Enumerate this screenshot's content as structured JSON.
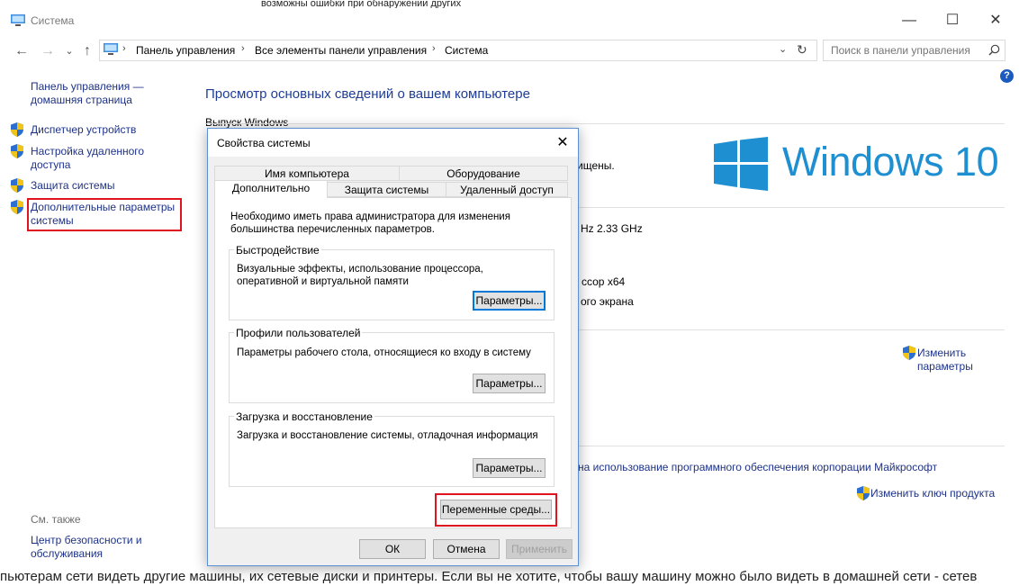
{
  "background_page": {
    "top_fragment": "возможны ошибки при обнаружении других",
    "bottom_fragment": "пьютерам сети видеть другие машины, их сетевые диски и принтеры. Если вы не хотите, чтобы вашу машину можно было видеть в домашней сети - сетев"
  },
  "window": {
    "title": "Система",
    "controls": {
      "minimize": "—",
      "maximize": "☐",
      "close": "✕"
    }
  },
  "nav": {
    "back": "←",
    "forward": "→",
    "dropdown": "⌄",
    "up": "↑",
    "breadcrumbs": [
      "Панель управления",
      "Все элементы панели управления",
      "Система"
    ],
    "refresh": "↻",
    "search_placeholder": "Поиск в панели управления",
    "help": "?"
  },
  "sidebar": {
    "home_link": "Панель управления —\nдомашняя страница",
    "items": [
      "Диспетчер устройств",
      "Настройка удаленного\nдоступа",
      "Защита системы",
      "Дополнительные параметры\nсистемы"
    ],
    "see_also_label": "См. также",
    "see_also_items": [
      "Центр безопасности и\nобслуживания"
    ]
  },
  "main": {
    "heading": "Просмотр основных сведений о вашем компьютере",
    "edition_label": "Выпуск Windows",
    "frag_protected": "ищены.",
    "frag_speed": "Hz  2.33 GHz",
    "frag_processor": "ссор x64",
    "frag_screen": "ого экрана",
    "change_params": "Изменить\nпараметры",
    "license_link": "на использование программного обеспечения корпорации Майкрософт",
    "change_key": "Изменить ключ продукта",
    "logo_text": "Windows 10"
  },
  "dialog": {
    "title": "Свойства системы",
    "close": "✕",
    "tabs_row1": [
      "Имя компьютера",
      "Оборудование"
    ],
    "tabs_row2": [
      "Дополнительно",
      "Защита системы",
      "Удаленный доступ"
    ],
    "admin_note": "Необходимо иметь права администратора для изменения большинства перечисленных параметров.",
    "performance": {
      "title": "Быстродействие",
      "desc": "Визуальные эффекты, использование процессора, оперативной и виртуальной памяти",
      "button": "Параметры..."
    },
    "profiles": {
      "title": "Профили пользователей",
      "desc": "Параметры рабочего стола, относящиеся ко входу в систему",
      "button": "Параметры..."
    },
    "startup": {
      "title": "Загрузка и восстановление",
      "desc": "Загрузка и восстановление системы, отладочная информация",
      "button": "Параметры..."
    },
    "env_button": "Переменные среды...",
    "ok": "ОК",
    "cancel": "Отмена",
    "apply": "Применить"
  },
  "colors": {
    "link": "#1e3287",
    "heading": "#1e3c96",
    "highlight": "#e0141e",
    "logo": "#1e90d2"
  }
}
